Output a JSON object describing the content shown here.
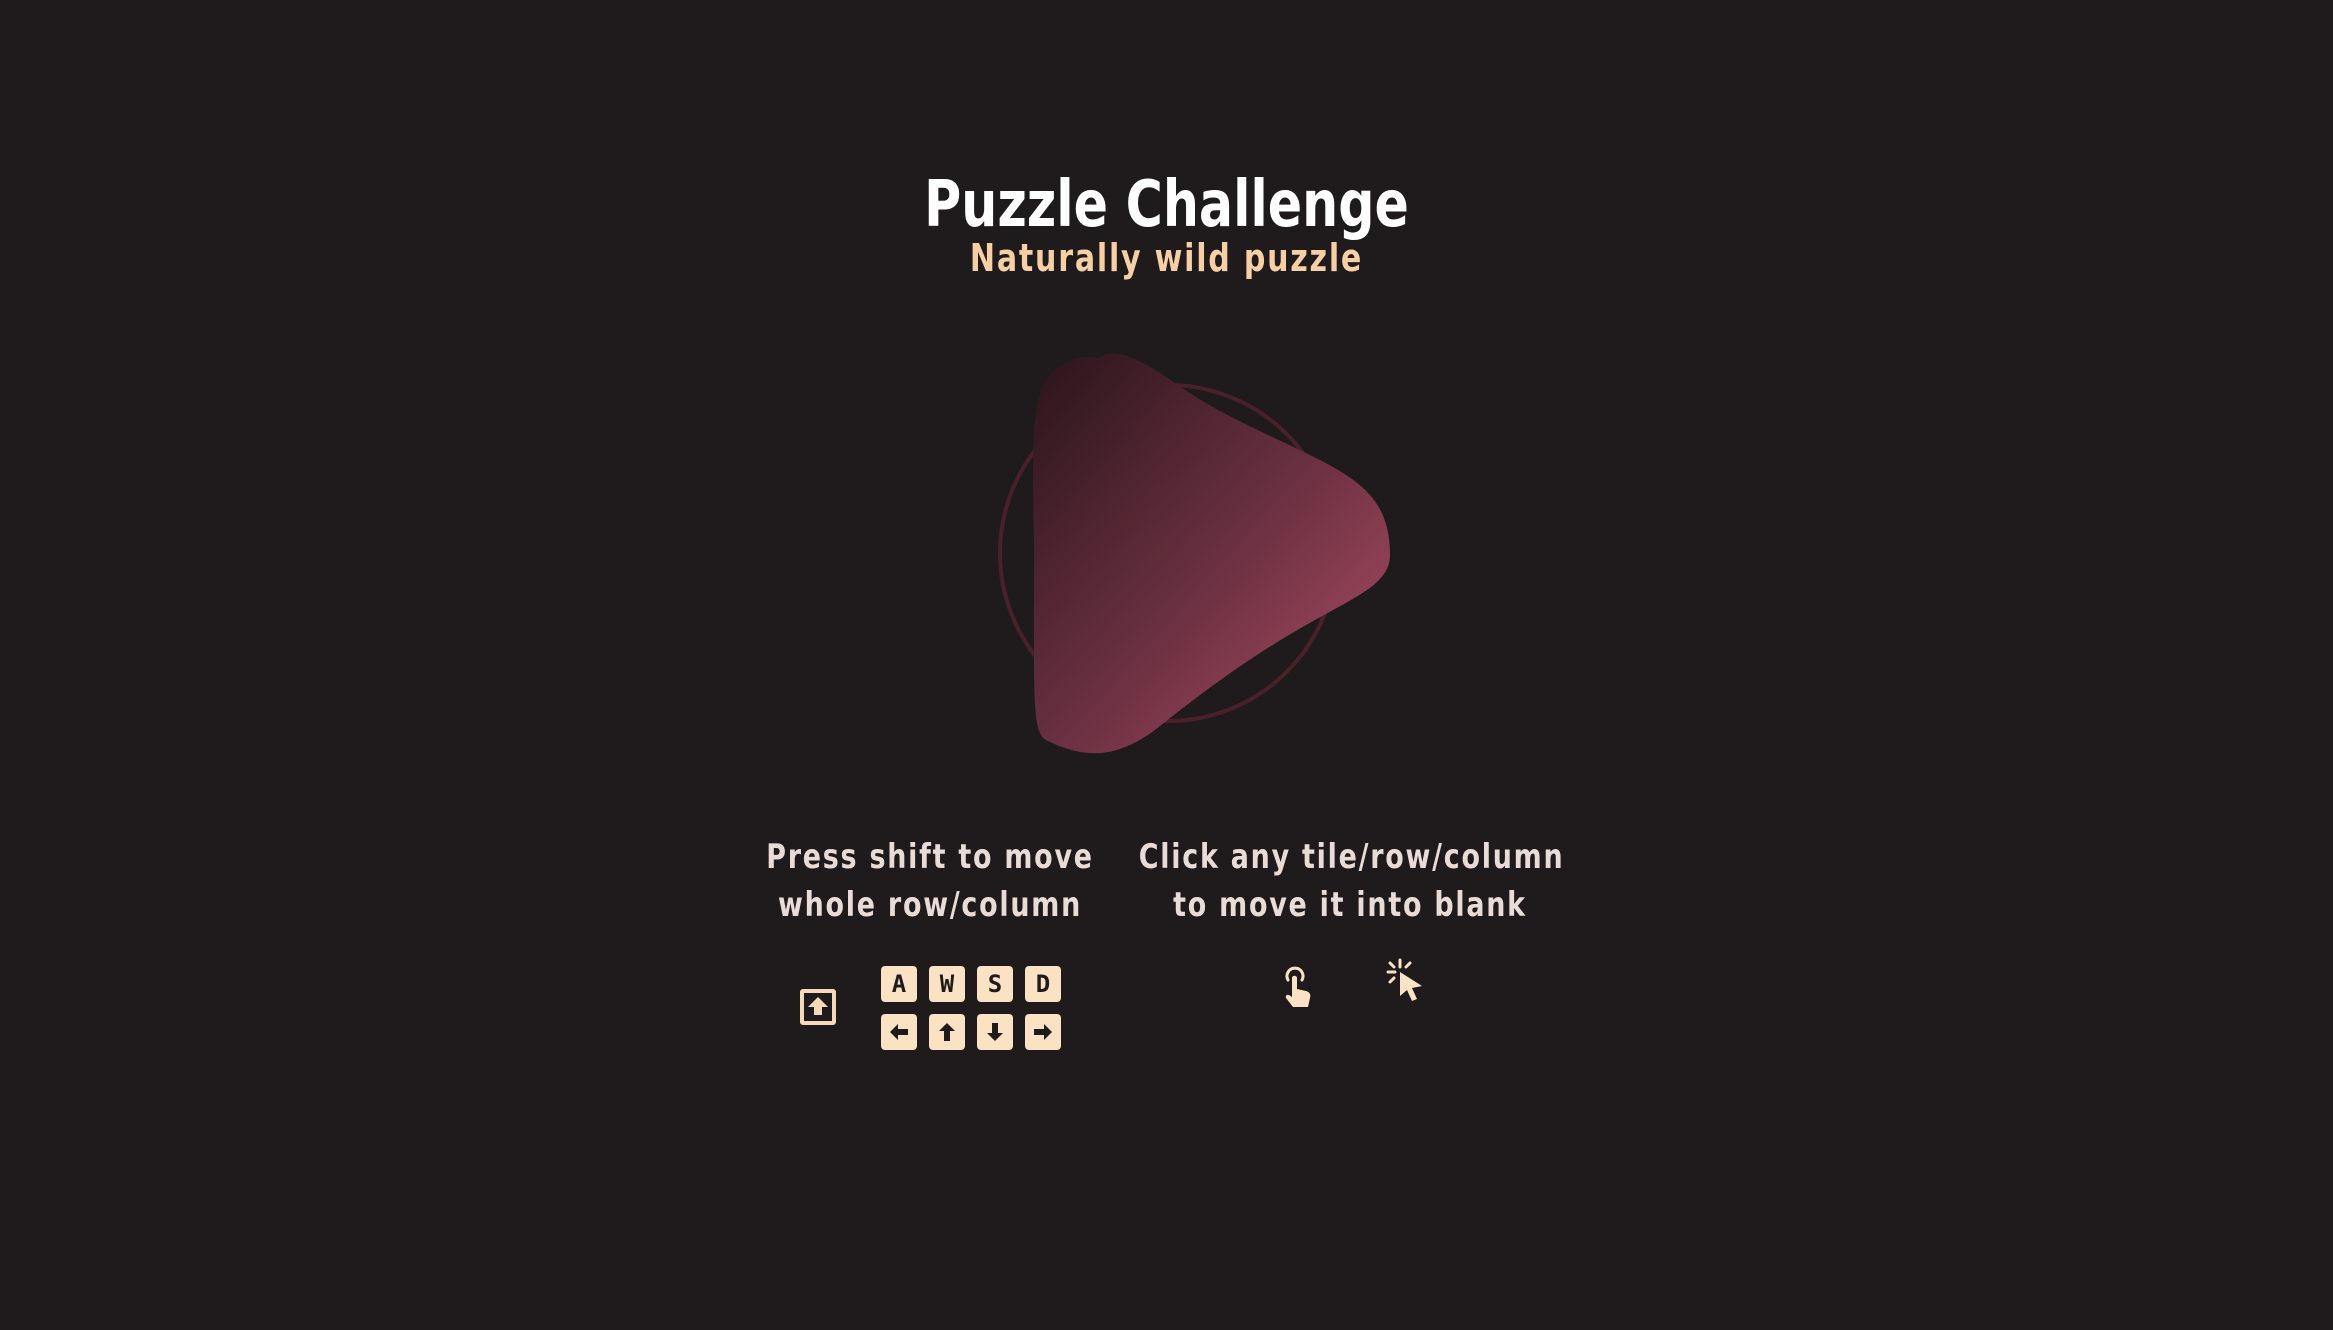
{
  "header": {
    "title": "Puzzle Challenge",
    "subtitle": "Naturally wild puzzle"
  },
  "play_button": {
    "icon": "play-icon",
    "gradient_start": "#2a1519",
    "gradient_end": "#a84a60",
    "ring_color": "#4a2128"
  },
  "instructions": {
    "shift": {
      "line1": "Press shift to move",
      "line2": "whole row/column"
    },
    "click": {
      "line1": "Click any tile/row/column",
      "line2": "to move it into blank"
    }
  },
  "keys": {
    "letters": [
      "A",
      "W",
      "S",
      "D"
    ],
    "arrows": [
      "arrow-left-icon",
      "arrow-up-icon",
      "arrow-down-icon",
      "arrow-right-icon"
    ],
    "shift_icon": "shift-key-icon"
  },
  "icons": {
    "touch": "touch-icon",
    "click": "mouse-click-icon"
  },
  "colors": {
    "background": "#1f1b1c",
    "title": "#ffffff",
    "accent": "#f6cfa5",
    "text": "#e9dcd6",
    "key": "#fbe2c4"
  }
}
